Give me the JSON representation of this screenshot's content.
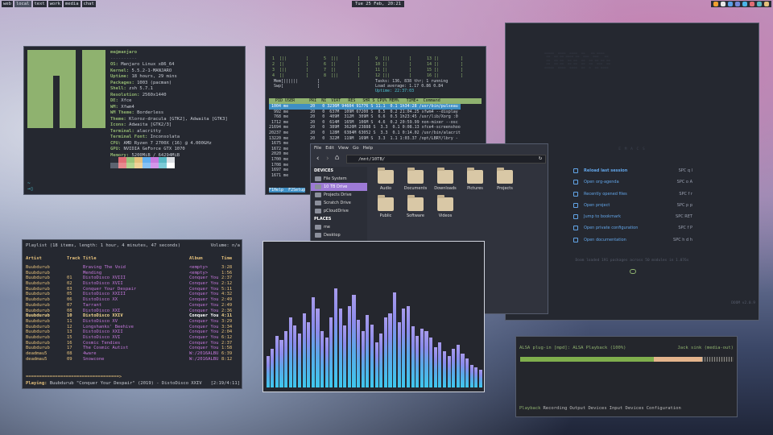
{
  "topbar": {
    "workspaces": [
      "web",
      "local",
      "text",
      "work",
      "media",
      "chat"
    ],
    "clock": {
      "date": "Tue 25 Feb,",
      "time": "20:21"
    }
  },
  "neofetch": {
    "user_host": "me@manjaro",
    "separator": "----------",
    "lines": [
      {
        "k": "OS:",
        "v": " Manjaro Linux x86_64"
      },
      {
        "k": "Kernel:",
        "v": " 5.5.2-1-MANJARO"
      },
      {
        "k": "Uptime:",
        "v": " 18 hours, 29 mins"
      },
      {
        "k": "Packages:",
        "v": " 1003 (pacman)"
      },
      {
        "k": "Shell:",
        "v": " zsh 5.7.1"
      },
      {
        "k": "Resolution:",
        "v": " 2560x1440"
      },
      {
        "k": "DE:",
        "v": " Xfce"
      },
      {
        "k": "WM:",
        "v": " Xfwm4"
      },
      {
        "k": "WM Theme:",
        "v": " Borderless"
      },
      {
        "k": "Theme:",
        "v": " Kloroz-dracula [GTK2], Adwaita [GTK3]"
      },
      {
        "k": "Icons:",
        "v": " Adwaita [GTK2/3]"
      },
      {
        "k": "Terminal:",
        "v": " alacritty"
      },
      {
        "k": "Terminal Font:",
        "v": " Inconsolata"
      },
      {
        "k": "CPU:",
        "v": " AMD Ryzen 7 2700X (16) @ 4.000GHz"
      },
      {
        "k": "GPU:",
        "v": " NVIDIA GeForce GTX 1070"
      },
      {
        "k": "Memory:",
        "v": " 5200MiB / 64294MiB"
      }
    ],
    "prompt": "~",
    "prompt2": "→▯",
    "swatches": [
      "#2b2e37",
      "#e06c75",
      "#98c379",
      "#e5c07b",
      "#61afef",
      "#c678dd",
      "#56b6c2",
      "#dcdfe4",
      "#5c6370",
      "#e88a8f",
      "#b2d48f",
      "#f0d197",
      "#86c1f4",
      "#d397ea",
      "#7ccad6",
      "#ffffff"
    ]
  },
  "htop": {
    "cpu_cols": [
      [
        "1  [||        ]",
        "2  [|         ]",
        "3  [||        ]",
        "4  [|         ]"
      ],
      [
        "5  [||        ]",
        "6  [|         ]",
        "7  [|         ]",
        "8  [||        ]"
      ],
      [
        "9  [||        ]",
        "10 [|         ]",
        "11 [|         ]",
        "12 [||        ]"
      ],
      [
        "13 [|         ]",
        "14 [|         ]",
        "15 [|         ]",
        "16 [|         ]"
      ]
    ],
    "mem": "Mem[||||||        ]",
    "swp": "Swp[              ]",
    "tasks": "Tasks: 136, 838 thr; 1 running",
    "load": "Load average: 1.17 0.86 0.84",
    "uptime": "Uptime: 22:37:03",
    "header": "  PID USER      PRI  NI  VIRT   RES   SHR S CPU% MEM%   TIME+  Command",
    "rows": [
      " 1004 me         20   0 3236M 94604 91776 S 11.1  0.1 1h34:28 /usr/bin/pulseau",
      "  992 me         20   0  637M  109M 67200 S  8.5  0.2 21:04.25 xfwm4 --display",
      "  768 me         20   0  409M  312M  309M S  6.6  0.5 1h23:45 /usr/lib/Xorg :0",
      " 1712 me         20   0  614M  165M  106M S  4.6  0.2 20:59.99 non-mixer --osc",
      "21694 me         20   0  389M  3620M 23888 S  3.3  0.1 0:08.13 xfce4-screenshoo",
      "20237 me         20   0  128M  6384M 63052 S  3.3  0.1 0:14.02 /usr/bin/alacrit",
      "13220 me         20   0  322M  119M  169M S  3.3  1.1 1:03.37 /opt/LBRY/lbry -",
      " 1675 me",
      " 1672 me",
      " 2020 me",
      " 1700 me",
      " 1708 me",
      " 1697 me",
      " 1671 me"
    ],
    "fkeys": "F1Help  F2Setup"
  },
  "filemanager": {
    "menu": [
      "File",
      "Edit",
      "View",
      "Go",
      "Help"
    ],
    "path": "/mnt/10TB/",
    "devices_header": "DEVICES",
    "devices": [
      "File System",
      "10 TB Drive",
      "Projects Drive",
      "Scratch Drive",
      "pCloudDrive"
    ],
    "places_header": "PLACES",
    "places": [
      "me",
      "Desktop"
    ],
    "folders": [
      "Audio",
      "Documents",
      "Downloads",
      "Pictures",
      "Projects",
      "Public",
      "Software",
      "Videos"
    ]
  },
  "cmus": {
    "title": "Playlist (18 items, length: 1 hour, 4 minutes, 47 seconds)",
    "volume": "Volume: n/a",
    "headers": {
      "artist": "Artist",
      "track": "Track",
      "title": "Title",
      "album": "Album",
      "time": "Time"
    },
    "rows": [
      [
        "Buubdurub",
        "",
        "Braving The Void",
        "<empty>",
        "3:28"
      ],
      [
        "Buubdurub",
        "",
        "Mending",
        "<empty>",
        "1:56"
      ],
      [
        "Buubdurub",
        "01",
        "DistoDisco XVIII",
        "Conquer You",
        "2:37"
      ],
      [
        "Buubdurub",
        "02",
        "DistoDisco XVII",
        "Conquer You",
        "2:12"
      ],
      [
        "Buubdurub",
        "03",
        "Conquer Your Despair",
        "Conquer You",
        "5:11"
      ],
      [
        "Buubdurub",
        "05",
        "DistoDisco XXIII",
        "Conquer You",
        "4:32"
      ],
      [
        "Buubdurub",
        "06",
        "DistoDisco XX",
        "Conquer You",
        "2:49"
      ],
      [
        "Buubdurub",
        "07",
        "Tarrant",
        "Conquer You",
        "2:49"
      ],
      [
        "Buubdurub",
        "08",
        "DistoDisco XXI",
        "Conquer You",
        "2:36"
      ],
      [
        "Buubdurub",
        "10",
        "DistoDisco XXIV",
        "Conquer You",
        "4:11"
      ],
      [
        "Buubdurub",
        "11",
        "DistoDisco XV",
        "Conquer You",
        "3:29"
      ],
      [
        "Buubdurub",
        "12",
        "Longshanks' Beehive",
        "Conquer You",
        "3:34"
      ],
      [
        "Buubdurub",
        "13",
        "DistoDisco XXII",
        "Conquer You",
        "2:04"
      ],
      [
        "Buubdurub",
        "15",
        "DistoDisco XVI",
        "Conquer You",
        "6:12"
      ],
      [
        "Buubdurub",
        "16",
        "Cosmic Tendies",
        "Conquer You",
        "2:37"
      ],
      [
        "Buubdurub",
        "17",
        "The Cosmic Autist",
        "Conquer You",
        "1:58"
      ],
      [
        "deadmau5",
        "08",
        "4ware",
        "W:/2016ALBU",
        "6:39"
      ],
      [
        "deadmau5",
        "09",
        "Snowcone",
        "W:/2016ALBU",
        "8:12"
      ]
    ],
    "current_index": 9,
    "progress": "===================================>",
    "playing_label": "Playing:",
    "playing": "Buubdurub \"Conquer Your Despair\" (2019) - DistoDisco XXIV",
    "position": "[2:19/4:11]"
  },
  "visualizer": {
    "levels": [
      0.28,
      0.34,
      0.46,
      0.42,
      0.5,
      0.62,
      0.55,
      0.48,
      0.66,
      0.58,
      0.8,
      0.7,
      0.5,
      0.44,
      0.62,
      0.88,
      0.7,
      0.55,
      0.72,
      0.82,
      0.6,
      0.5,
      0.64,
      0.56,
      0.4,
      0.48,
      0.62,
      0.66,
      0.84,
      0.58,
      0.7,
      0.72,
      0.54,
      0.46,
      0.52,
      0.5,
      0.44,
      0.36,
      0.4,
      0.32,
      0.28,
      0.34,
      0.38,
      0.3,
      0.26,
      0.2,
      0.18,
      0.16
    ]
  },
  "doom": {
    "emacs_label": "E M A C S",
    "menu": [
      {
        "label": "Reload last session",
        "key": "SPC q l"
      },
      {
        "label": "Open org-agenda",
        "key": "SPC o A"
      },
      {
        "label": "Recently opened files",
        "key": "SPC f r"
      },
      {
        "label": "Open project",
        "key": "SPC p p"
      },
      {
        "label": "Jump to bookmark",
        "key": "SPC RET"
      },
      {
        "label": "Open private configuration",
        "key": "SPC f P"
      },
      {
        "label": "Open documentation",
        "key": "SPC h d h"
      }
    ],
    "loaded": "Doom loaded 191 packages across 50 modules in 1.076s",
    "version": "DOOM v2.0.9"
  },
  "alsa": {
    "title": "ALSA plug-in [mpd]: ALSA Playback (100%)",
    "sink": "Jack sink (media-out)",
    "level": 1.0,
    "tabs": [
      "Playback",
      "Recording",
      "Output Devices",
      "Input Devices",
      "Configuration"
    ]
  }
}
